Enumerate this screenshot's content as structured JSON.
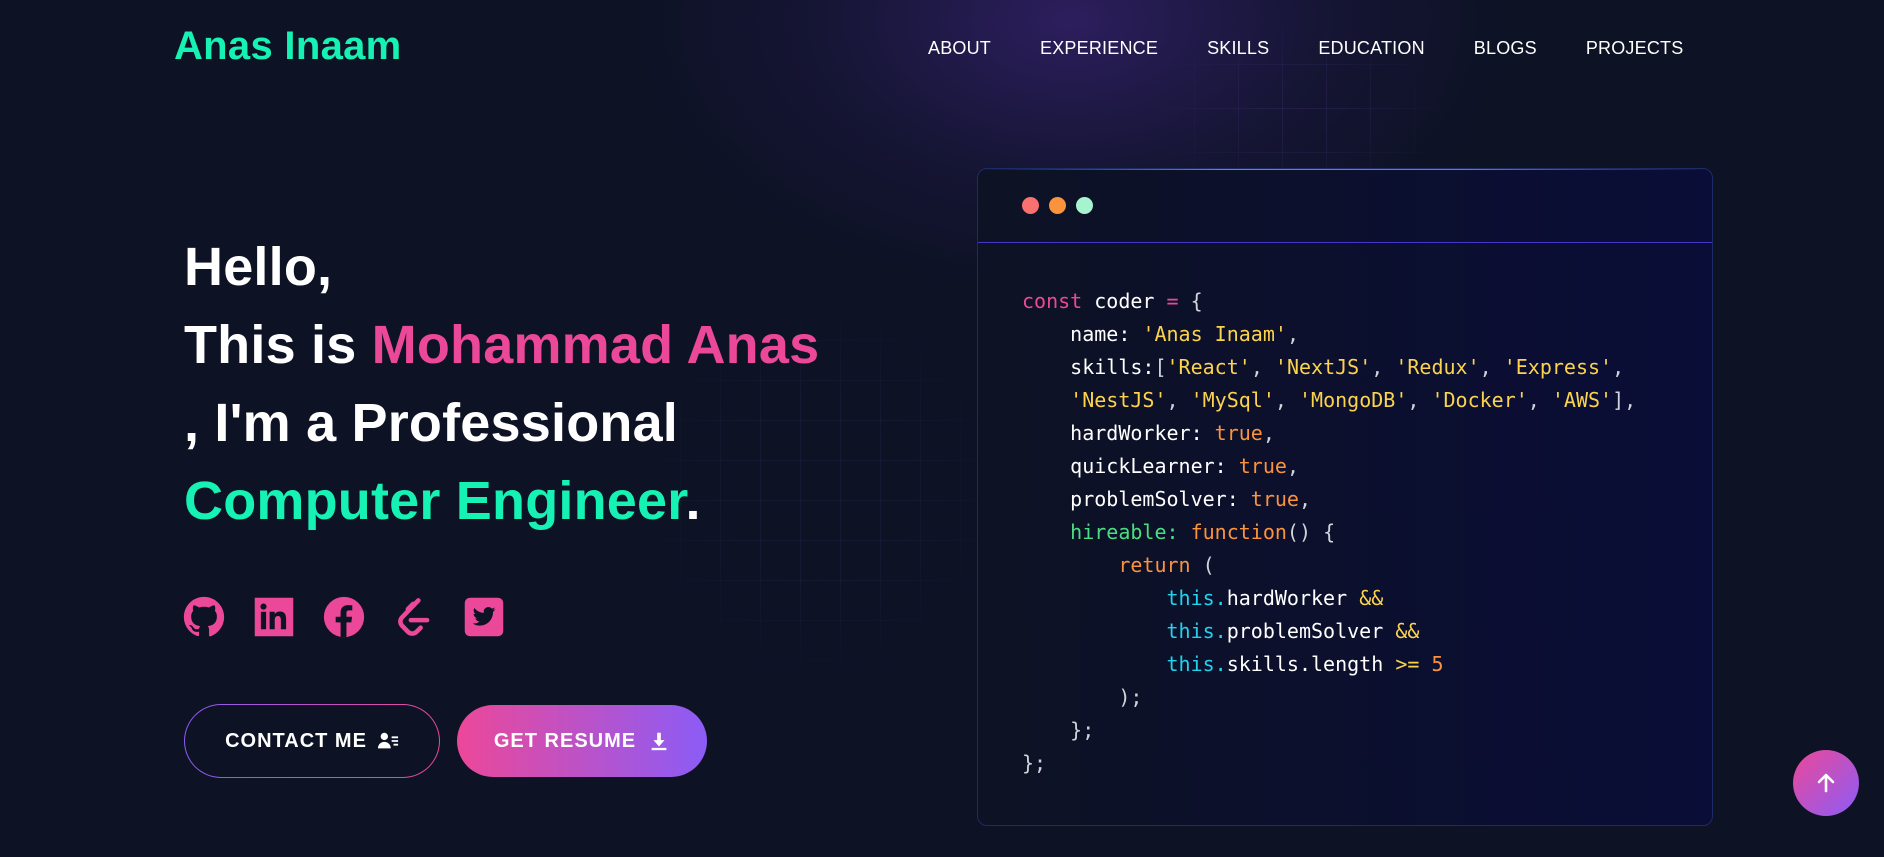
{
  "header": {
    "logo": "Anas Inaam",
    "nav": [
      {
        "label": "ABOUT"
      },
      {
        "label": "EXPERIENCE"
      },
      {
        "label": "SKILLS"
      },
      {
        "label": "EDUCATION"
      },
      {
        "label": "BLOGS"
      },
      {
        "label": "PROJECTS"
      }
    ]
  },
  "hero": {
    "greeting": "Hello,",
    "intro_prefix": "This is ",
    "name": "Mohammad Anas",
    "role_prefix": ", I'm a Professional",
    "role": "Computer Engineer",
    "role_suffix": "."
  },
  "socials": [
    {
      "name": "github",
      "icon": "github-icon"
    },
    {
      "name": "linkedin",
      "icon": "linkedin-icon"
    },
    {
      "name": "facebook",
      "icon": "facebook-icon"
    },
    {
      "name": "leetcode",
      "icon": "leetcode-icon"
    },
    {
      "name": "twitter",
      "icon": "twitter-icon"
    }
  ],
  "buttons": {
    "contact_label": "CONTACT ME",
    "resume_label": "GET RESUME"
  },
  "code_card": {
    "tokens": {
      "const": "const",
      "var": "coder",
      "assign": "=",
      "open_brace": "{",
      "name_key": "name:",
      "name_val": "'Anas Inaam'",
      "skills_key": "skills:",
      "skills_line1": [
        "'React'",
        "'NextJS'",
        "'Redux'",
        "'Express'"
      ],
      "skills_line2": [
        "'NestJS'",
        "'MySql'",
        "'MongoDB'",
        "'Docker'",
        "'AWS'"
      ],
      "hardworker_key": "hardWorker:",
      "quicklearner_key": "quickLearner:",
      "problemsolver_key": "problemSolver:",
      "true": "true",
      "hireable_key": "hireable:",
      "function": "function",
      "parens": "()",
      "return": "return",
      "this": "this.",
      "hardworker_prop": "hardWorker",
      "problemsolver_prop": "problemSolver",
      "skills_length": "skills.length",
      "and": "&&",
      "gte": ">=",
      "five": "5",
      "close_paren": ");",
      "close_fn": "};",
      "close_obj": "};"
    }
  },
  "colors": {
    "background": "#0d1224",
    "accent_green": "#16f2b3",
    "accent_pink": "#ec4899",
    "accent_violet": "#8b5cf6"
  }
}
